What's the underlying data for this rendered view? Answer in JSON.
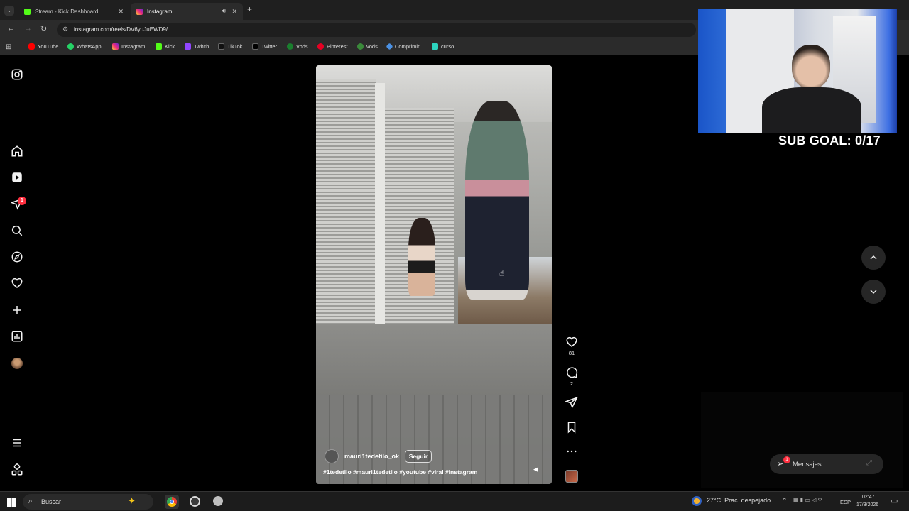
{
  "browser": {
    "tabs": [
      {
        "title": "Stream - Kick Dashboard",
        "favicon_color": "#53fc18"
      },
      {
        "title": "Instagram",
        "favicon_color": "#e1306c"
      }
    ],
    "url": "instagram.com/reels/DV6yuJuEWD9/",
    "bookmarks": [
      {
        "label": "YouTube",
        "color": "#ff0000"
      },
      {
        "label": "WhatsApp",
        "color": "#25d366"
      },
      {
        "label": "Instagram",
        "color": "#e1306c"
      },
      {
        "label": "Kick",
        "color": "#53fc18"
      },
      {
        "label": "Twitch",
        "color": "#9146ff"
      },
      {
        "label": "TikTok",
        "color": "#ffffff"
      },
      {
        "label": "Twitter",
        "color": "#ffffff"
      },
      {
        "label": "Vods",
        "color": "#53fc18"
      },
      {
        "label": "Pinterest",
        "color": "#e60023"
      },
      {
        "label": "vods",
        "color": "#53fc18"
      },
      {
        "label": "Comprimir",
        "color": "#4a90e2"
      },
      {
        "label": "curso",
        "color": "#2dd4bf"
      }
    ]
  },
  "sidebar": {
    "items": [
      {
        "icon": "instagram-logo-icon"
      },
      {
        "icon": "home-icon"
      },
      {
        "icon": "reels-icon"
      },
      {
        "icon": "messages-icon",
        "badge": "1"
      },
      {
        "icon": "search-icon"
      },
      {
        "icon": "explore-icon"
      },
      {
        "icon": "notifications-icon"
      },
      {
        "icon": "create-icon"
      },
      {
        "icon": "dashboard-icon"
      },
      {
        "icon": "profile-avatar"
      },
      {
        "icon": "menu-icon"
      },
      {
        "icon": "also-from-meta-icon"
      }
    ]
  },
  "reel": {
    "username": "mauri1tedetilo_ok",
    "follow_label": "Seguir",
    "caption": "#1tedetilo #mauri1tedetilo #youtube #viral #instagram",
    "likes": "81",
    "comments": "2"
  },
  "overlay": {
    "sub_goal": "SUB GOAL: 0/17"
  },
  "messages_bar": {
    "label": "Mensajes",
    "badge": "1"
  },
  "taskbar": {
    "search_placeholder": "Buscar",
    "weather": "27°C  Prac. despejado",
    "language": "ESP",
    "time": "02:47",
    "date": "17/3/2026"
  }
}
